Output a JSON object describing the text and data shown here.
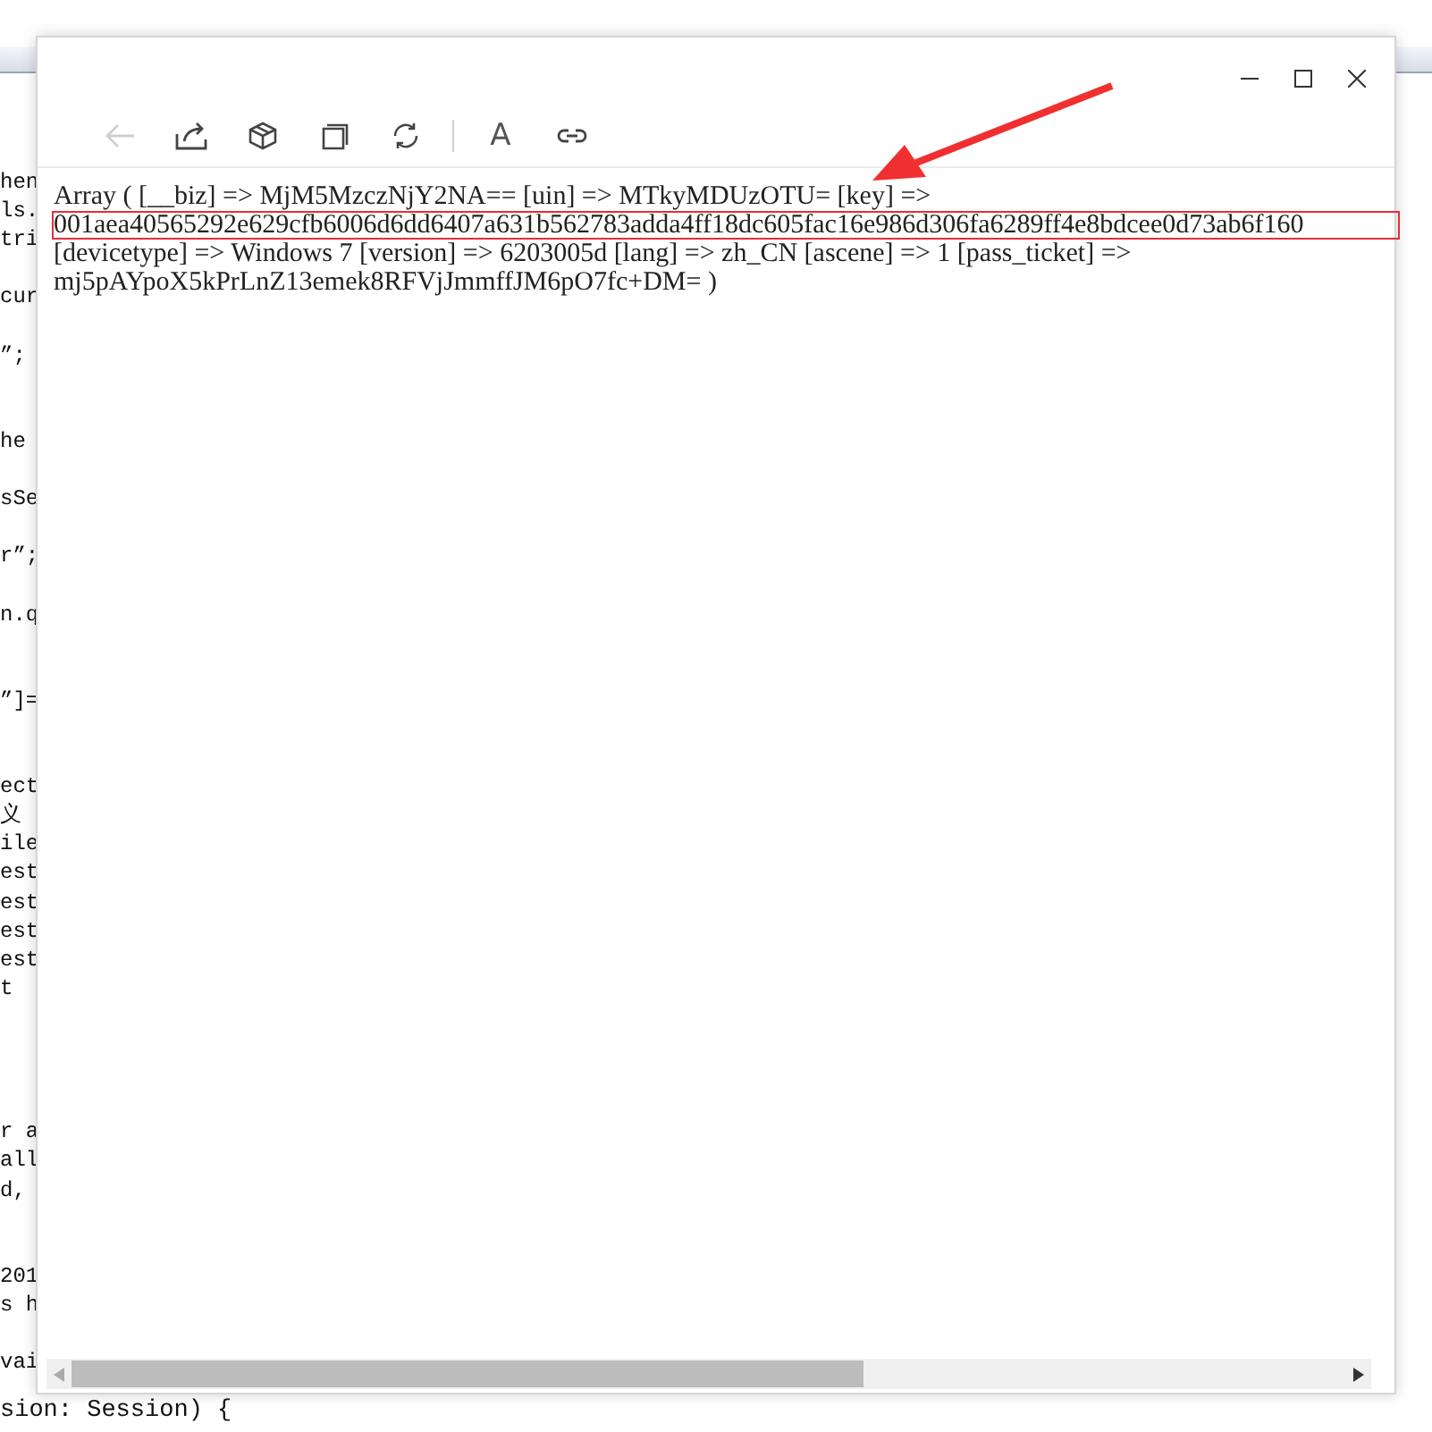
{
  "background_code": {
    "lines": [
      "hen",
      "ls.",
      "tri",
      "cur",
      "”;",
      "he",
      "sSe",
      "r”;",
      "n.q",
      "”]=",
      "ect",
      "义",
      "ile",
      "est",
      "est",
      "est",
      "est",
      "t",
      "r a",
      "all",
      "d,",
      "201",
      "s h",
      "vai"
    ],
    "below_window": "sion: Session) {"
  },
  "window": {
    "controls": [
      {
        "kind": "minimize"
      },
      {
        "kind": "maximize"
      },
      {
        "kind": "close"
      }
    ]
  },
  "toolbar": [
    {
      "kind": "back",
      "disabled": true
    },
    {
      "kind": "share",
      "disabled": false
    },
    {
      "kind": "cube",
      "disabled": false
    },
    {
      "kind": "copy",
      "disabled": false
    },
    {
      "kind": "refresh",
      "disabled": false
    },
    {
      "kind": "separator"
    },
    {
      "kind": "text",
      "label": "A",
      "disabled": false
    },
    {
      "kind": "link",
      "disabled": false
    }
  ],
  "output": {
    "before_key": "Array ( [__biz] => MjM5MzczNjY2NA== [uin] => MTkyMDUzOTU= [key] =>",
    "key_value": "001aea40565292e629cfb6006d6dd6407a631b562783adda4ff18dc605fac16e986d306fa6289ff4e8bdcee0d73ab6f160",
    "key_highlighted": true,
    "after_key": "[devicetype] => Windows 7 [version] => 6203005d [lang] => zh_CN [ascene] => 1 [pass_ticket] => mj5pAYpoX5kPrLnZ13emek8RFVjJmmffJM6pO7fc+DM= )"
  }
}
